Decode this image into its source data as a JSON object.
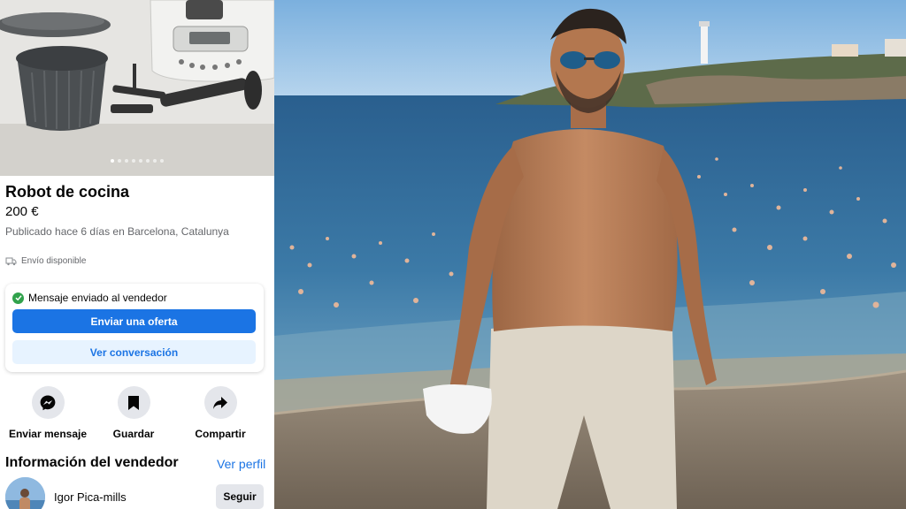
{
  "listing": {
    "title": "Robot de cocina",
    "price": "200 €",
    "published": "Publicado hace 6 días en Barcelona, Catalunya",
    "shipping": "Envío disponible",
    "gallery_dots": 8,
    "gallery_active": 0
  },
  "message_card": {
    "status": "Mensaje enviado al vendedor",
    "offer_button": "Enviar una oferta",
    "conversation_button": "Ver conversación"
  },
  "actions": [
    {
      "label": "Enviar mensaje",
      "icon": "messenger-icon"
    },
    {
      "label": "Guardar",
      "icon": "bookmark-icon"
    },
    {
      "label": "Compartir",
      "icon": "share-icon"
    }
  ],
  "seller": {
    "heading": "Información del vendedor",
    "profile_link": "Ver perfil",
    "name": "Igor Pica-mills",
    "follow_button": "Seguir"
  },
  "colors": {
    "accent": "#1b74e4",
    "accent_light": "#e7f3ff",
    "success": "#31a24c",
    "button_gray": "#e4e6eb"
  }
}
